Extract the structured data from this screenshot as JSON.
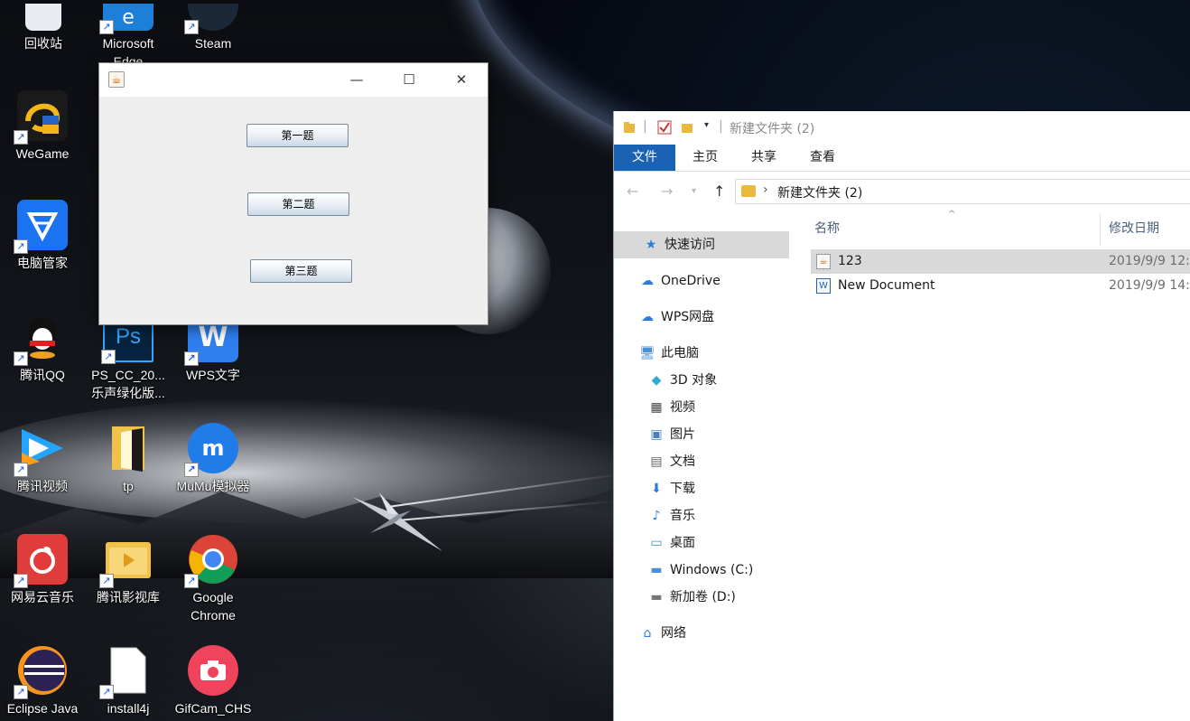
{
  "desktop": {
    "icons": [
      {
        "label": "回收站",
        "icon": "recycle-bin-icon",
        "color": "#e8ecf0"
      },
      {
        "label": "Microsoft Edge",
        "icon": "edge-icon",
        "color": "#1e7fd8"
      },
      {
        "label": "Steam",
        "icon": "steam-icon",
        "color": "#1b2838"
      },
      {
        "label": "WeGame",
        "icon": "wegame-icon",
        "color": "#f3b61a"
      },
      {
        "label": "电脑管家",
        "icon": "pc-manager-icon",
        "color": "#1a73f0"
      },
      {
        "label": "腾讯QQ",
        "icon": "qq-icon",
        "color": "#111111"
      },
      {
        "label": "PS_CC_20... 乐声绿化版...",
        "icon": "photoshop-icon",
        "color": "#07233d"
      },
      {
        "label": "WPS文字",
        "icon": "wps-writer-icon",
        "color": "#2f7ff0"
      },
      {
        "label": "腾讯视频",
        "icon": "tencent-video-icon",
        "color": "#22a4ff"
      },
      {
        "label": "tp",
        "icon": "folder-icon",
        "color": "#f0c24a"
      },
      {
        "label": "MuMu模拟器",
        "icon": "mumu-icon",
        "color": "#1f7ce8"
      },
      {
        "label": "网易云音乐",
        "icon": "netease-music-icon",
        "color": "#e03c3c"
      },
      {
        "label": "腾讯影视库",
        "icon": "media-library-icon",
        "color": "#f0c24a"
      },
      {
        "label": "Google Chrome",
        "icon": "chrome-icon",
        "color": "#db4437"
      },
      {
        "label": "Eclipse Java",
        "icon": "eclipse-icon",
        "color": "#2c2255"
      },
      {
        "label": "install4j",
        "icon": "document-icon",
        "color": "#ffffff"
      },
      {
        "label": "GifCam_CHS",
        "icon": "gifcam-icon",
        "color": "#f0445c"
      }
    ]
  },
  "swing_window": {
    "title": "",
    "buttons": [
      "第一题",
      "第二题",
      "第三题"
    ],
    "controls": {
      "minimize": "—",
      "maximize": "☐",
      "close": "✕"
    }
  },
  "explorer": {
    "title": "新建文件夹 (2)",
    "ribbon_tabs": [
      "文件",
      "主页",
      "共享",
      "查看"
    ],
    "address_path": "新建文件夹 (2)",
    "nav_items": [
      {
        "label": "快速访问",
        "icon": "star-icon",
        "selected": true
      },
      {
        "label": "OneDrive",
        "icon": "cloud-icon"
      },
      {
        "label": "WPS网盘",
        "icon": "cloud-outline-icon"
      },
      {
        "label": "此电脑",
        "icon": "computer-icon"
      },
      {
        "label": "3D 对象",
        "icon": "cube-icon"
      },
      {
        "label": "视频",
        "icon": "film-icon"
      },
      {
        "label": "图片",
        "icon": "picture-icon"
      },
      {
        "label": "文档",
        "icon": "document-icon"
      },
      {
        "label": "下载",
        "icon": "download-icon"
      },
      {
        "label": "音乐",
        "icon": "music-icon"
      },
      {
        "label": "桌面",
        "icon": "desktop-icon"
      },
      {
        "label": "Windows (C:)",
        "icon": "drive-icon"
      },
      {
        "label": "新加卷 (D:)",
        "icon": "drive-icon"
      },
      {
        "label": "网络",
        "icon": "network-icon"
      }
    ],
    "columns": {
      "name": "名称",
      "modified": "修改日期"
    },
    "files": [
      {
        "name": "123",
        "modified": "2019/9/9 12:",
        "icon": "java-file-icon",
        "selected": true
      },
      {
        "name": "New Document",
        "modified": "2019/9/9 14:",
        "icon": "wps-document-icon"
      }
    ],
    "accent": "#1a63b4"
  }
}
